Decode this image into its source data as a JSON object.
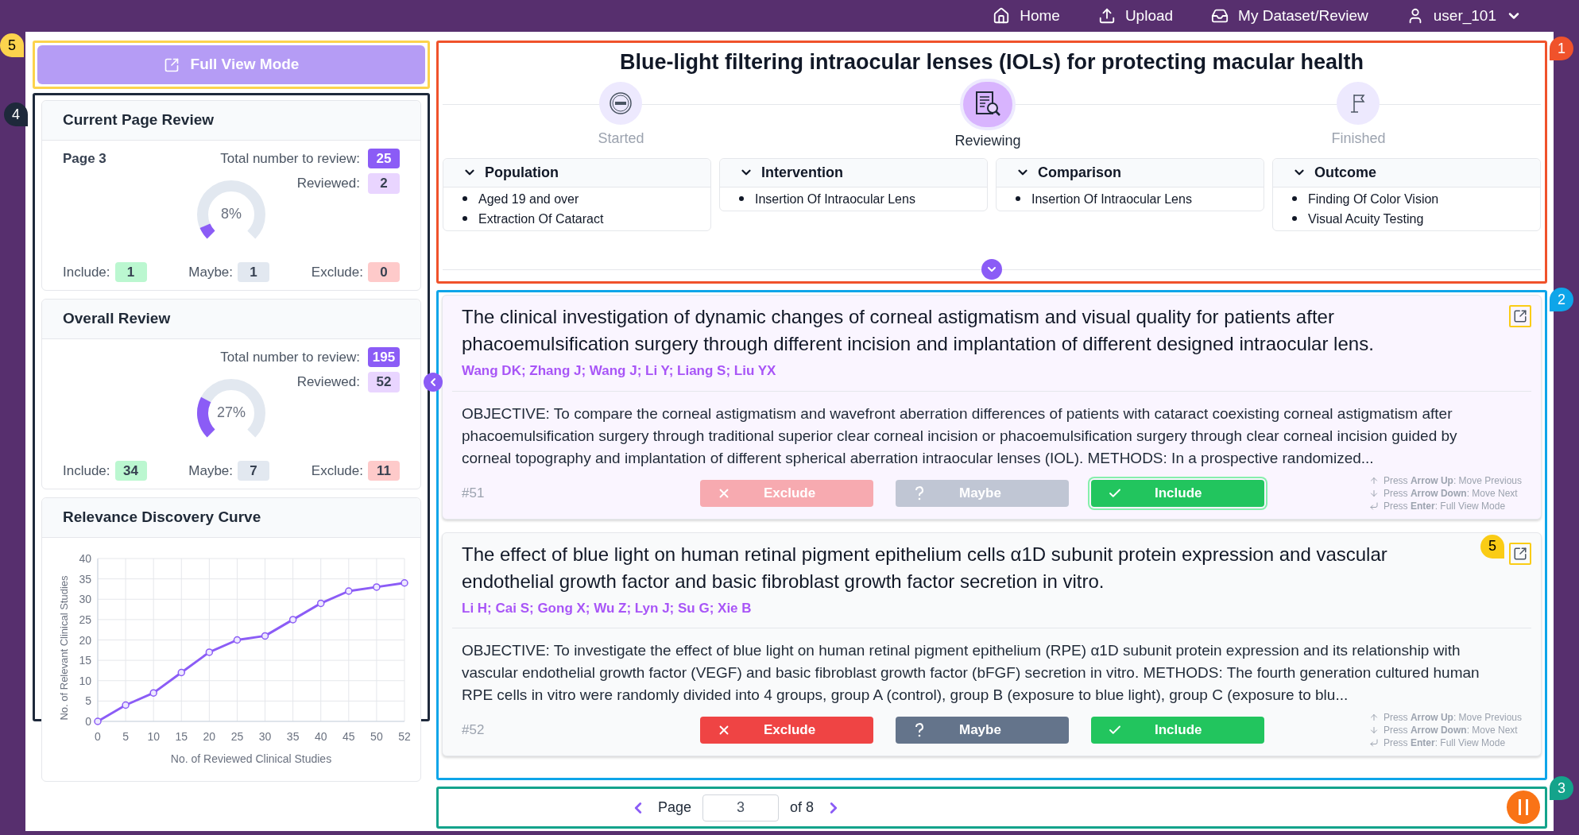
{
  "nav": [
    {
      "label": "Home",
      "menu": false
    },
    {
      "label": "Upload",
      "menu": false
    },
    {
      "label": "My Dataset/Review",
      "menu": false
    },
    {
      "label": "user_101",
      "menu": true
    }
  ],
  "full_view_button": {
    "label": "Full View Mode",
    "callout": {
      "label": "5",
      "color": "#fcd34d"
    }
  },
  "stats_panel": {
    "callout": {
      "label": "4",
      "color": "#1e293b"
    },
    "current_page": {
      "title": "Current Page Review",
      "page_label": "Page 3",
      "total_label": "Total number to review:",
      "total": "25",
      "reviewed_label": "Reviewed:",
      "reviewed": "2",
      "percent": "8%",
      "level": 0.08,
      "counts": [
        {
          "kind": "include",
          "label": "Include:",
          "value": "1"
        },
        {
          "kind": "maybe",
          "label": "Maybe:",
          "value": "1"
        },
        {
          "kind": "exclude",
          "label": "Exclude:",
          "value": "0"
        }
      ]
    },
    "overall": {
      "title": "Overall Review",
      "total_label": "Total number to review:",
      "total": "195",
      "reviewed_label": "Reviewed:",
      "reviewed": "52",
      "percent": "27%",
      "level": 0.27,
      "counts": [
        {
          "kind": "include",
          "label": "Include:",
          "value": "34"
        },
        {
          "kind": "maybe",
          "label": "Maybe:",
          "value": "7"
        },
        {
          "kind": "exclude",
          "label": "Exclude:",
          "value": "11"
        }
      ]
    },
    "curve": {
      "title": "Relevance Discovery Curve",
      "chart_data": {
        "type": "line",
        "xlabel": "No. of Reviewed Clinical Studies",
        "ylabel": "No. of Relevant Clinical Studies",
        "categories": [
          "0",
          "5",
          "10",
          "15",
          "20",
          "25",
          "30",
          "35",
          "40",
          "45",
          "50",
          "52"
        ],
        "ylim": [
          0,
          40
        ],
        "grid": true,
        "yticks": [
          0,
          5,
          10,
          15,
          20,
          25,
          30,
          35,
          40
        ],
        "series": [
          {
            "color": "#8b5cf6",
            "marker": "circle",
            "values": [
              0,
              4,
              7,
              12,
              17,
              20,
              21,
              25,
              29,
              32,
              33,
              34
            ]
          }
        ]
      }
    }
  },
  "topic": {
    "title": "Blue-light filtering intraocular lenses (IOLs) for protecting macular health",
    "callout": {
      "label": "1",
      "color": "#f0522b"
    },
    "steps": [
      {
        "kind": "start",
        "label": "Started",
        "selected": false
      },
      {
        "kind": "review",
        "label": "Reviewing",
        "selected": true
      },
      {
        "kind": "finish",
        "label": "Finished",
        "selected": false
      }
    ],
    "pico": [
      {
        "title": "Population",
        "items": [
          "Aged 19 and over",
          "Extraction Of Cataract"
        ]
      },
      {
        "title": "Intervention",
        "items": [
          "Insertion Of Intraocular Lens"
        ]
      },
      {
        "title": "Comparison",
        "items": [
          "Insertion Of Intraocular Lens"
        ]
      },
      {
        "title": "Outcome",
        "items": [
          "Finding Of Color Vision",
          "Visual Acuity Testing"
        ]
      }
    ]
  },
  "review_list": {
    "callout": {
      "label": "2",
      "color": "#0ea5e9"
    },
    "cards": [
      {
        "title": "The clinical investigation of dynamic changes of corneal astigmatism and visual quality for patients after phacoemulsification surgery through different incision and implantation of different designed intraocular lens.",
        "authors": "Wang DK; Zhang J; Wang J; Li Y; Liang S; Liu YX",
        "abstract": "OBJECTIVE: To compare the corneal astigmatism and wavefront aberration differences of patients with cataract coexisting corneal astigmatism after phacoemulsification surgery through traditional superior clear corneal incision or phacoemulsification surgery through clear corneal incision guided by corneal topography and implantation of different spherical aberration intraocular lenses (IOL). METHODS: In a prospective randomized...",
        "number": "#51",
        "expand_callout": {
          "color": "#facc15"
        },
        "buttons": [
          {
            "kind": "exclude",
            "label": "Exclude",
            "selected": false
          },
          {
            "kind": "maybe",
            "label": "Maybe",
            "selected": false
          },
          {
            "kind": "include",
            "label": "Include",
            "selected": true
          }
        ],
        "hints": [
          {
            "kind": "up",
            "text": "Press **Arrow Up**: Move Previous"
          },
          {
            "kind": "down",
            "text": "Press **Arrow Down**: Move Next"
          },
          {
            "kind": "enter",
            "text": "Press **Enter**: Full View Mode"
          }
        ]
      },
      {
        "title": "The effect of blue light on human retinal pigment epithelium cells α1D subunit protein expression and vascular endothelial growth factor and basic fibroblast growth factor secretion in vitro.",
        "authors": "Li H; Cai S; Gong X; Wu Z; Lyn J; Su G; Xie B",
        "abstract": "OBJECTIVE: To investigate the effect of blue light on human retinal pigment epithelium (RPE) α1D subunit protein expression and its relationship with vascular endothelial growth factor (VEGF) and basic fibroblast growth factor (bFGF) secretion in vitro. METHODS: The fourth generation cultured human RPE cells in vitro were randomly divided into 4 groups, group A (control), group B (exposure to blue light), group C (exposure to blu...",
        "number": "#52",
        "expand_callout": {
          "color": "#facc15",
          "label": "5"
        },
        "buttons": [
          {
            "kind": "exclude",
            "label": "Exclude",
            "selected": false
          },
          {
            "kind": "maybe",
            "label": "Maybe",
            "selected": false
          },
          {
            "kind": "include",
            "label": "Include",
            "selected": false
          }
        ],
        "hints": [
          {
            "kind": "up",
            "text": "Press **Arrow Up**: Move Previous"
          },
          {
            "kind": "down",
            "text": "Press **Arrow Down**: Move Next"
          },
          {
            "kind": "enter",
            "text": "Press **Enter**: Full View Mode"
          }
        ]
      }
    ]
  },
  "pagination": {
    "callout": {
      "label": "3",
      "color": "#14a38b"
    },
    "page_label": "Page",
    "page": "3",
    "of_label": "of 8"
  }
}
